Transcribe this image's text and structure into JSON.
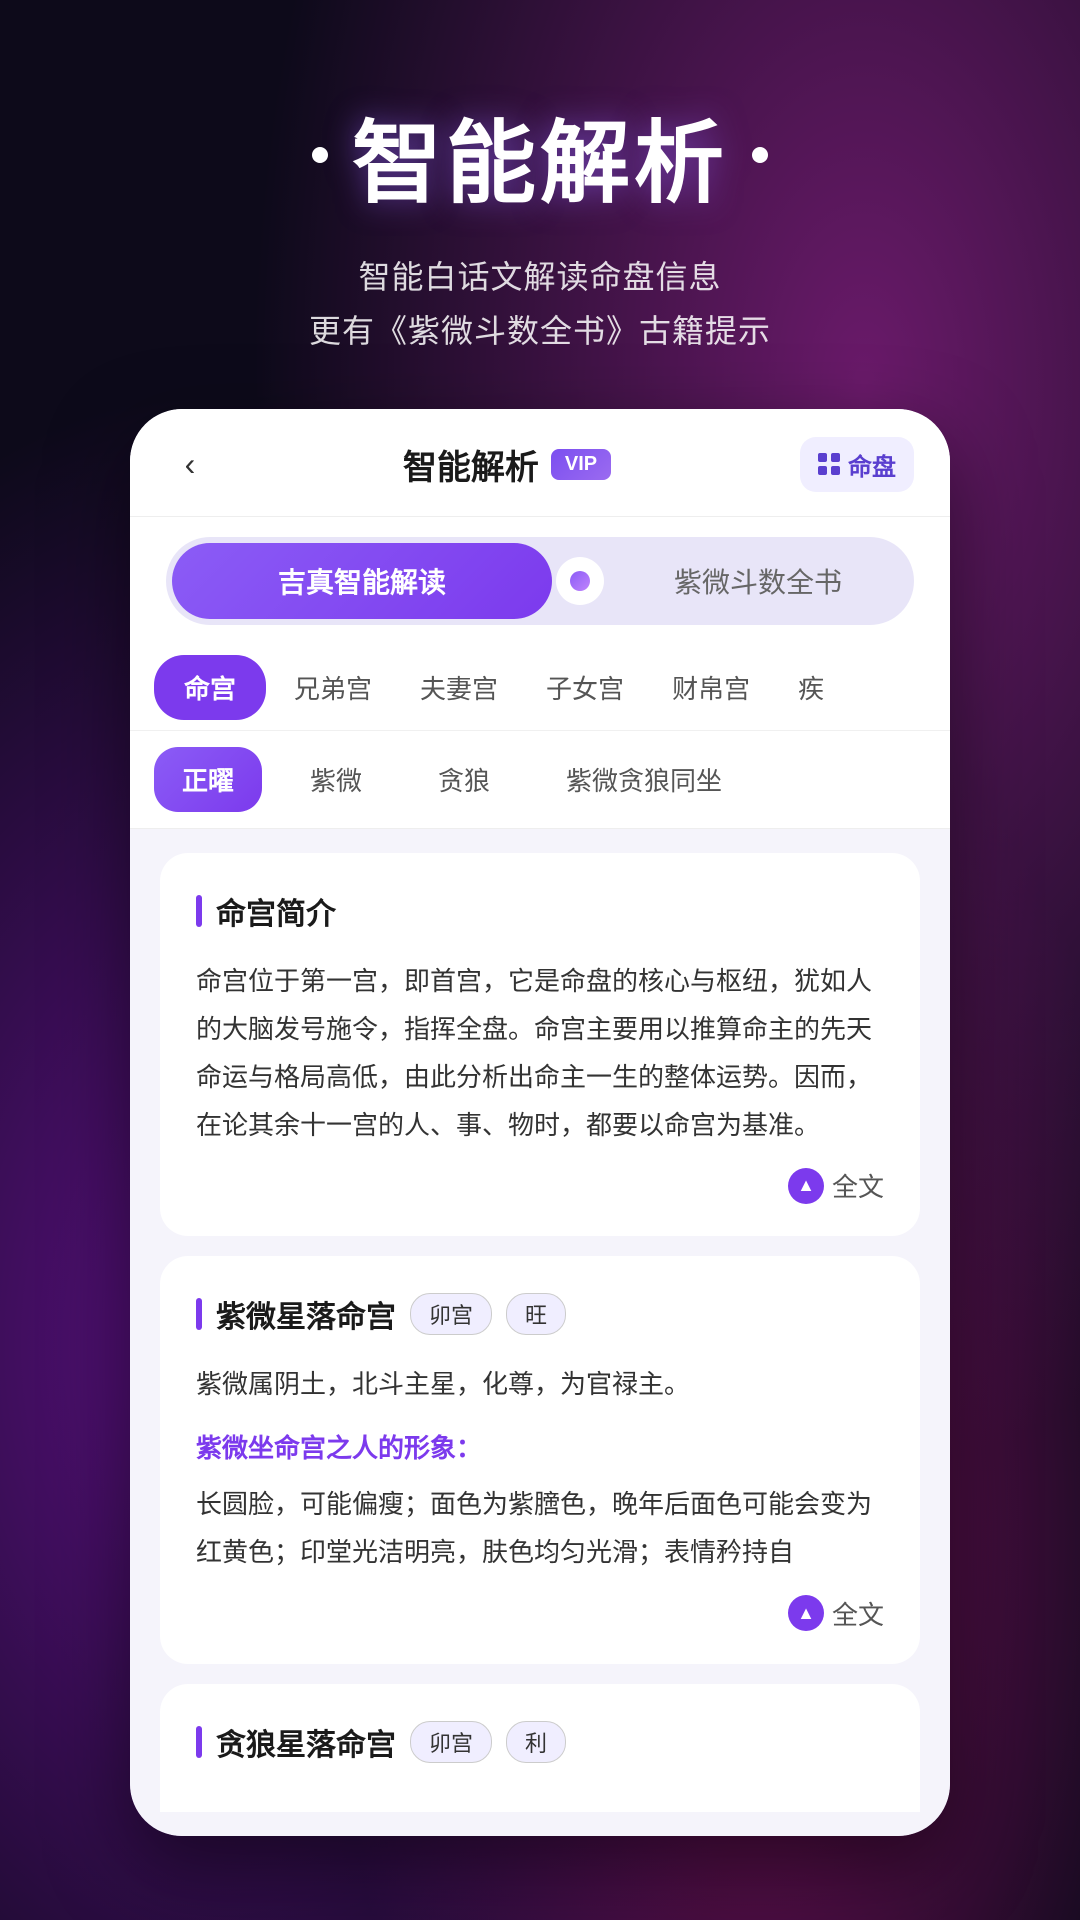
{
  "hero": {
    "title": "智能解析",
    "subtitle_line1": "智能白话文解读命盘信息",
    "subtitle_line2": "更有《紫微斗数全书》古籍提示"
  },
  "app": {
    "nav": {
      "back_icon": "‹",
      "title": "智能解析",
      "vip_label": "VIP",
      "right_btn": "命盘"
    },
    "toggle": {
      "option1": "吉真智能解读",
      "option2": "紫微斗数全书"
    },
    "tabs1": [
      {
        "label": "命宫",
        "active": true
      },
      {
        "label": "兄弟宫",
        "active": false
      },
      {
        "label": "夫妻宫",
        "active": false
      },
      {
        "label": "子女宫",
        "active": false
      },
      {
        "label": "财帛宫",
        "active": false
      },
      {
        "label": "疾",
        "active": false
      }
    ],
    "tabs2": [
      {
        "label": "正曜",
        "active": true
      },
      {
        "label": "紫微",
        "active": false
      },
      {
        "label": "贪狼",
        "active": false
      },
      {
        "label": "紫微贪狼同坐",
        "active": false
      }
    ],
    "card1": {
      "title": "命宫简介",
      "body": "命宫位于第一宫，即首宫，它是命盘的核心与枢纽，犹如人的大脑发号施令，指挥全盘。命宫主要用以推算命主的先天命运与格局高低，由此分析出命主一生的整体运势。因而，在论其余十一宫的人、事、物时，都要以命宫为基准。",
      "read_more": "全文"
    },
    "card2": {
      "title": "紫微星落命宫",
      "badge1": "卯宫",
      "badge2": "旺",
      "body": "紫微属阴土，北斗主星，化尊，为官禄主。",
      "sub_title": "紫微坐命宫之人的形象：",
      "sub_body": "长圆脸，可能偏瘦；面色为紫膪色，晚年后面色可能会变为红黄色；印堂光洁明亮，肤色均匀光滑；表情矜持自",
      "read_more": "全文"
    },
    "card3": {
      "title": "贪狼星落命宫",
      "badge1": "卯宫",
      "badge2": "利"
    }
  }
}
